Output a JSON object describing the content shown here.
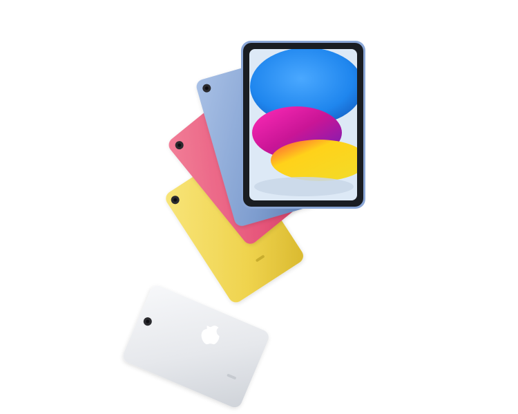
{
  "product": {
    "name": "iPad",
    "device_colors": [
      {
        "name": "silver",
        "hex": "#e9ebee"
      },
      {
        "name": "yellow",
        "hex": "#f2dc5d"
      },
      {
        "name": "pink",
        "hex": "#e8547a"
      },
      {
        "name": "blue",
        "hex": "#7f9fd0"
      }
    ],
    "frame_color": "#1a1d22",
    "wallpaper_colors": {
      "background": "#dde9f6",
      "top_disc": "#2b8cf0",
      "middle_disc": "#d81a9a",
      "lower_disc": "#f2d81c"
    },
    "icons": [
      "apple-logo-icon",
      "camera-icon"
    ]
  }
}
